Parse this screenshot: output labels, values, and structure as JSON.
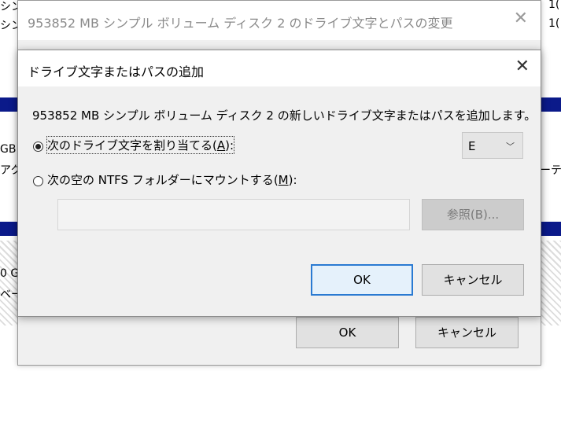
{
  "background": {
    "frag_left_1": "シンプル",
    "frag_left_2": "シン",
    "frag_left_3": "GB",
    "frag_left_4": "アク",
    "frag_left_5": "0 G",
    "frag_left_6": "ベー",
    "frag_right_1": "1(",
    "frag_right_2": "1(",
    "frag_right_3": "ーティ"
  },
  "outer_dialog": {
    "title": "953852 MB  シンプル ボリューム ディスク 2 のドライブ文字とパスの変更",
    "ok_label": "OK",
    "cancel_label": "キャンセル"
  },
  "dialog": {
    "title": "ドライブ文字またはパスの追加",
    "description": "953852 MB  シンプル ボリューム ディスク 2 の新しいドライブ文字またはパスを追加します。",
    "option_assign_label": "次のドライブ文字を割り当てる",
    "option_assign_mnemonic": "A",
    "option_mount_label": "次の空の NTFS フォルダーにマウントする",
    "option_mount_mnemonic": "M",
    "drive_letter": "E",
    "browse_label": "参照(B)...",
    "ok_label": "OK",
    "cancel_label": "キャンセル"
  }
}
